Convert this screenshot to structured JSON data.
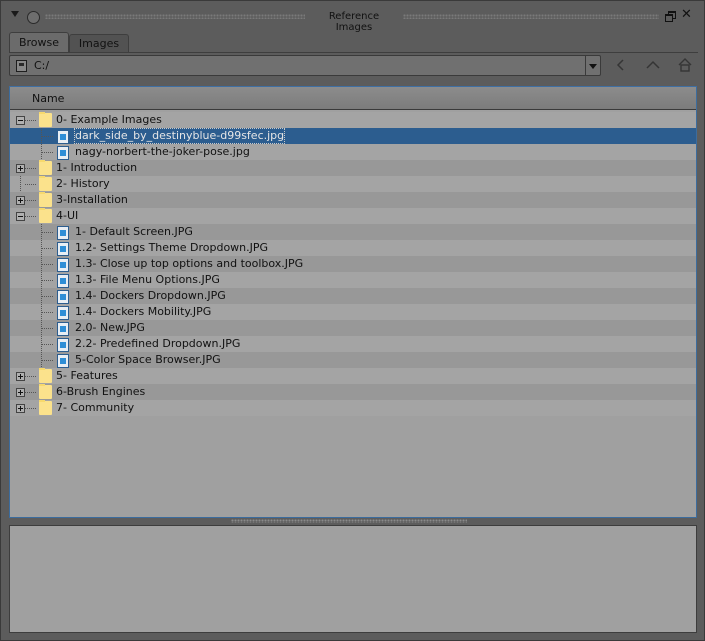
{
  "window": {
    "title": "Reference Images"
  },
  "tabs": [
    {
      "label": "Browse",
      "active": true
    },
    {
      "label": "Images",
      "active": false
    }
  ],
  "path": {
    "value": "C:/"
  },
  "tree": {
    "header": "Name",
    "rows": [
      {
        "label": "0- Example Images",
        "type": "folder",
        "level": 0,
        "state": "expanded"
      },
      {
        "label": "dark_side_by_destinyblue-d99sfec.jpg",
        "type": "file",
        "level": 1,
        "selected": true
      },
      {
        "label": "nagy-norbert-the-joker-pose.jpg",
        "type": "file",
        "level": 1
      },
      {
        "label": "1- Introduction",
        "type": "folder",
        "level": 0,
        "state": "collapsed"
      },
      {
        "label": "2- History",
        "type": "folder",
        "level": 0,
        "state": "none"
      },
      {
        "label": "3-Installation",
        "type": "folder",
        "level": 0,
        "state": "collapsed"
      },
      {
        "label": "4-UI",
        "type": "folder",
        "level": 0,
        "state": "expanded"
      },
      {
        "label": "1- Default Screen.JPG",
        "type": "file",
        "level": 1
      },
      {
        "label": "1.2- Settings Theme Dropdown.JPG",
        "type": "file",
        "level": 1
      },
      {
        "label": "1.3- Close up top options and toolbox.JPG",
        "type": "file",
        "level": 1
      },
      {
        "label": "1.3- File Menu Options.JPG",
        "type": "file",
        "level": 1
      },
      {
        "label": "1.4- Dockers Dropdown.JPG",
        "type": "file",
        "level": 1
      },
      {
        "label": "1.4- Dockers Mobility.JPG",
        "type": "file",
        "level": 1
      },
      {
        "label": "2.0- New.JPG",
        "type": "file",
        "level": 1
      },
      {
        "label": "2.2- Predefined Dropdown.JPG",
        "type": "file",
        "level": 1
      },
      {
        "label": "5-Color Space Browser.JPG",
        "type": "file",
        "level": 1
      },
      {
        "label": "5- Features",
        "type": "folder",
        "level": 0,
        "state": "collapsed"
      },
      {
        "label": "6-Brush Engines",
        "type": "folder",
        "level": 0,
        "state": "collapsed"
      },
      {
        "label": "7- Community",
        "type": "folder",
        "level": 0,
        "state": "collapsed"
      }
    ]
  },
  "icons": {
    "collapse": "chevron-down-icon",
    "lock": "lock-icon",
    "float": "float-window-icon",
    "close": "close-icon",
    "drive": "drive-icon",
    "back": "back-arrow-icon",
    "up": "up-arrow-icon",
    "home": "home-icon",
    "folder": "folder-icon",
    "image": "image-file-icon"
  },
  "colors": {
    "selection": "#2c5d8f",
    "folder": "#fbe28c",
    "focus_border": "#3b6c9e"
  }
}
